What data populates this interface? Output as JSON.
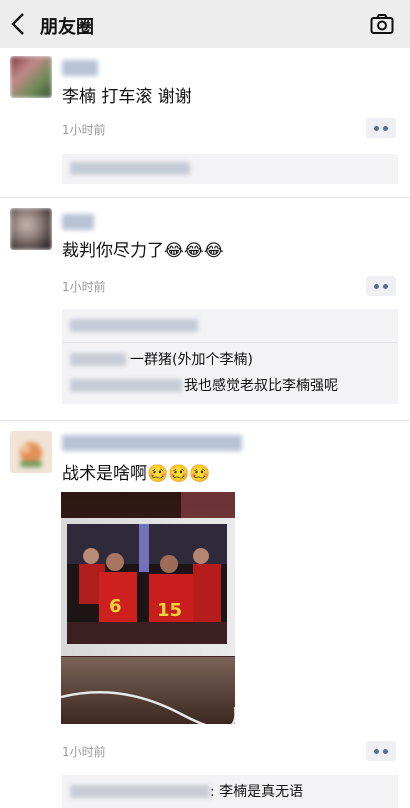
{
  "header": {
    "title": "朋友圈",
    "back_icon": "chevron-left-icon",
    "camera_icon": "camera-icon"
  },
  "posts": [
    {
      "text": "李楠 打车滚 谢谢",
      "time": "1小时前"
    },
    {
      "text": "裁判你尽力了😂😂😂",
      "time": "1小时前",
      "comments": [
        {
          "text": "一群猪(外加个李楠)"
        },
        {
          "text": "我也感觉老叔比李楠强呢"
        }
      ]
    },
    {
      "text": "战术是啥啊",
      "text_emoji": "🥴🥴🥴",
      "time": "1小时前",
      "photo": {
        "jersey_left": "6",
        "jersey_right": "15"
      },
      "comments": [
        {
          "text": ": 李楠是真无语"
        }
      ]
    }
  ],
  "colors": {
    "header_bg": "#ededed",
    "link_blue": "#5a6b92",
    "comment_bg": "#f3f3f5"
  }
}
